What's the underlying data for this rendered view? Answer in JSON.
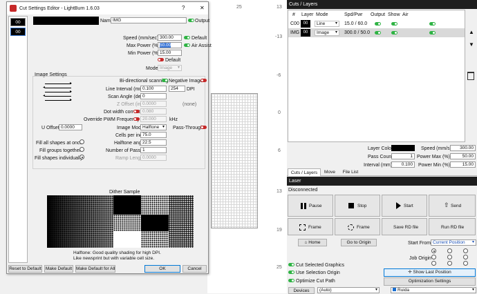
{
  "ruler": {
    "top_numbers": [
      "25",
      "13",
      "-13"
    ],
    "left_numbers": [
      "-13",
      "-6",
      "0",
      "6",
      "13",
      "19",
      "25"
    ]
  },
  "dialog": {
    "title": "Cut Settings Editor - LightBurn 1.6.03",
    "help": "?",
    "close": "✕",
    "layer_list": [
      "00",
      "00"
    ],
    "name_label": "Name",
    "name_value": "IMG",
    "output_label": "Output",
    "speed_label": "Speed (mm/sec)",
    "speed_value": "300.00",
    "default_label": "Default",
    "max_power_label": "Max Power (%)",
    "max_power_value": "50.00",
    "air_assist_label": "Air Assist",
    "min_power_label": "Min Power (%)",
    "min_power_value": "15.00",
    "power_default_label": "Default",
    "mode_label": "Mode",
    "mode_value": "Image",
    "image_settings_title": "Image Settings",
    "bidir_label": "Bi-directional scanning",
    "negative_label": "Negative Image",
    "line_interval_label": "Line Interval (mm)",
    "line_interval_value": "0.100",
    "dpi_value": "254",
    "dpi_label": "DPI",
    "scan_angle_label": "Scan Angle (deg)",
    "scan_angle_value": "0",
    "z_offset_label": "Z Offset (in)",
    "z_offset_value": "0.0000",
    "z_offset_none": "(none)",
    "dot_width_label": "Dot width correction",
    "dot_width_value": "0.080",
    "pwm_label": "Override PWM Frequency",
    "pwm_value": "20.000",
    "pwm_unit": "kHz",
    "u_offset_label": "U Offset",
    "u_offset_value": "0.0000",
    "image_mode_label": "Image Mode",
    "image_mode_value": "Halftone",
    "pass_through_label": "Pass-Through",
    "cells_label": "Cells per inch",
    "cells_value": "75.0",
    "fill_all_label": "Fill all shapes at once",
    "halftone_angle_label": "Halftone angle",
    "halftone_angle_value": "22.5",
    "fill_groups_label": "Fill groups together",
    "passes_label": "Number of Passes",
    "passes_value": "1",
    "fill_individually_label": "Fill shapes individually",
    "ramp_label": "Ramp Length",
    "ramp_value": "0.0000",
    "dither_title": "Dither Sample",
    "dither_desc_1": "Halftone: Good quality shading for high DPI.",
    "dither_desc_2": "Like newsprint but with variable cell size.",
    "reset_default": "Reset to Default",
    "make_default": "Make Default",
    "make_default_all": "Make Default for All",
    "ok": "OK",
    "cancel": "Cancel"
  },
  "cuts_layers": {
    "title": "Cuts / Layers",
    "headers": [
      "#",
      "Layer",
      "Mode",
      "Spd/Pwr",
      "Output",
      "Show",
      "Air"
    ],
    "rows": [
      {
        "num": "C00",
        "layer": "00",
        "mode": "Line",
        "spdpwr": "15.0 / 60.0"
      },
      {
        "num": "IMG",
        "layer": "00",
        "mode": "Image",
        "spdpwr": "300.0 / 50.0"
      }
    ],
    "layer_color_label": "Layer Color",
    "speed_label": "Speed (mm/s)",
    "speed_value": "300.00",
    "pass_count_label": "Pass Count",
    "pass_count_value": "1",
    "power_max_label": "Power Max (%)",
    "power_max_value": "50.00",
    "interval_label": "Interval (mm)",
    "interval_value": "0.100",
    "power_min_label": "Power Min (%)",
    "power_min_value": "15.00",
    "tabs": [
      "Cuts / Layers",
      "Move",
      "File List"
    ]
  },
  "laser": {
    "title": "Laser",
    "status": "Disconnected",
    "pause": "Pause",
    "stop": "Stop",
    "start": "Start",
    "send": "Send",
    "frame1": "Frame",
    "frame2": "Frame",
    "save_rd": "Save RD file",
    "run_rd": "Run RD file",
    "home": "Home",
    "go_to_origin": "Go to Origin",
    "start_from_label": "Start From:",
    "start_from_value": "Current Position",
    "job_origin_label": "Job Origin",
    "cut_selected": "Cut Selected Graphics",
    "use_selection": "Use Selection Origin",
    "optimize_cut": "Optimize Cut Path",
    "show_last": "Show Last Position",
    "optimization": "Optimization Settings",
    "devices": "Devices",
    "auto": "(Auto)",
    "device_name": "Ruida"
  }
}
